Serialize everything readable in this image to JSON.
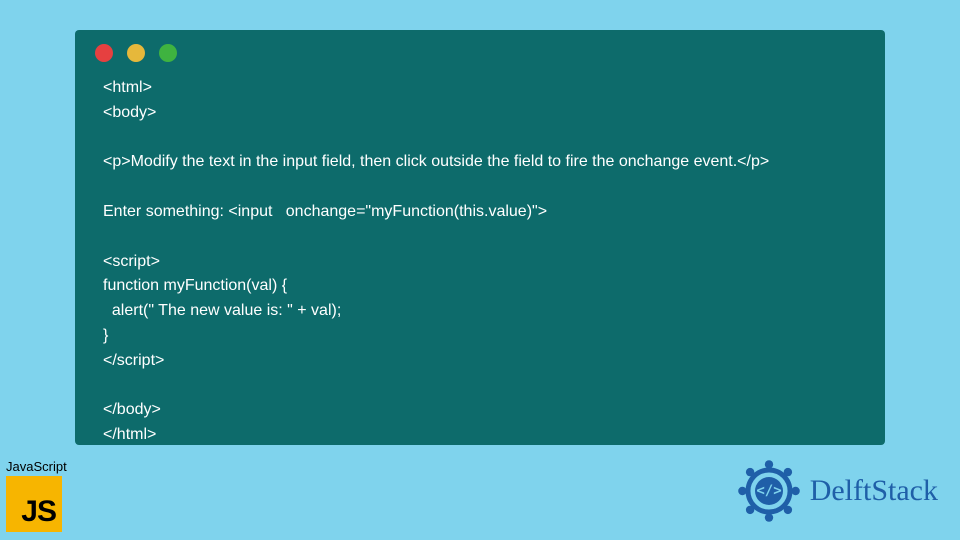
{
  "window": {
    "dots": [
      "red",
      "yellow",
      "green"
    ]
  },
  "code": {
    "lines": [
      "<html>",
      "<body>",
      "",
      "<p>Modify the text in the input field, then click outside the field to fire the onchange event.</p>",
      "",
      "Enter something: <input   onchange=\"myFunction(this.value)\">",
      "",
      "<script>",
      "function myFunction(val) {",
      "  alert(\" The new value is: \" + val);",
      "}",
      "</script>",
      "",
      "</body>",
      "</html>"
    ]
  },
  "badges": {
    "js_label": "JavaScript",
    "js_logo_text": "JS",
    "delft_text": "DelftStack"
  },
  "colors": {
    "page_bg": "#7fd3ed",
    "window_bg": "#0d6b6b",
    "js_bg": "#f7b500",
    "delft_blue": "#1f5fa8"
  }
}
